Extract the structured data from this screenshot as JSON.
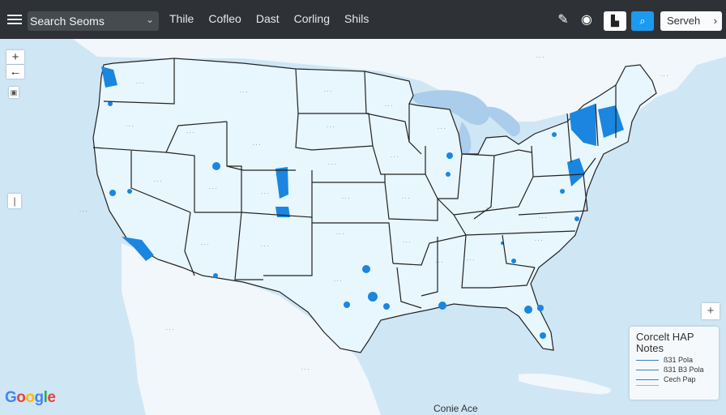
{
  "toolbar": {
    "search_text": "Search Seoms",
    "nav": [
      "Thile",
      "Cofleo",
      "Dast",
      "Corling",
      "Shils"
    ],
    "search_button": "Serveh"
  },
  "map_controls": {
    "zoom_in": "+",
    "zoom_out": "←",
    "side_handle": "|",
    "expand": "+"
  },
  "legend": {
    "title": "Corcelt HAP",
    "subtitle": "Notes",
    "items": [
      "ß31 Pola",
      "ß31 B3 Pola",
      "Cech Pap"
    ]
  },
  "google_letters": [
    {
      "ch": "G",
      "color": "#4285F4"
    },
    {
      "ch": "o",
      "color": "#EA4335"
    },
    {
      "ch": "o",
      "color": "#FBBC05"
    },
    {
      "ch": "g",
      "color": "#4285F4"
    },
    {
      "ch": "l",
      "color": "#34A853"
    },
    {
      "ch": "e",
      "color": "#EA4335"
    }
  ],
  "bottom_label": "Conie Ace",
  "colors": {
    "topbar": "#2e3236",
    "land": "#e8f6fd",
    "outer_land": "#f1f7fa",
    "water": "#cfe6f5",
    "highlight": "#1a86e0",
    "border": "#222222",
    "accent_button": "#1a9bf0"
  }
}
